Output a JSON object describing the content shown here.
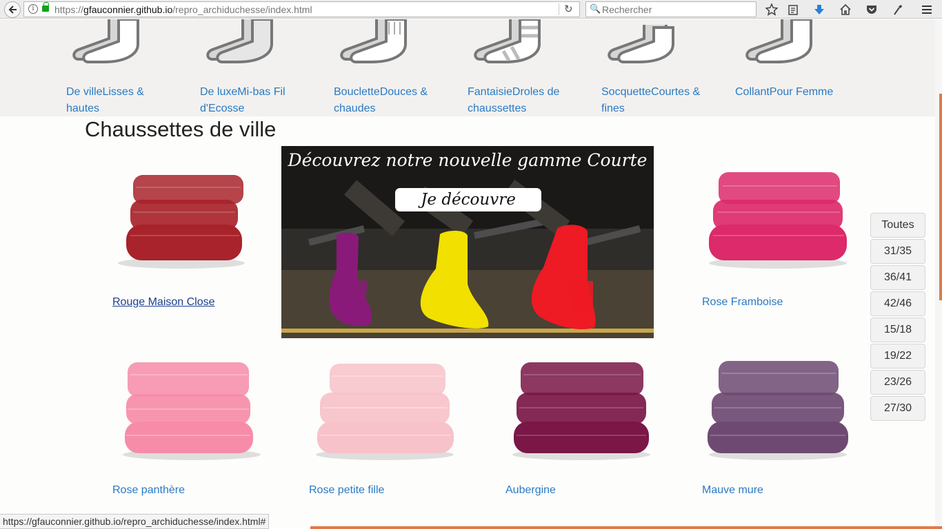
{
  "browser": {
    "url_prefix": "https://",
    "url_host": "gfauconnier.github.io",
    "url_path": "/repro_archiduchesse/index.html",
    "search_placeholder": "Rechercher"
  },
  "categories": [
    {
      "label": "De villeLisses & hautes"
    },
    {
      "label": "De luxeMi-bas Fil d'Ecosse"
    },
    {
      "label": "BoucletteDouces & chaudes"
    },
    {
      "label": "FantaisieDroles de chaussettes"
    },
    {
      "label": "SocquetteCourtes & fines"
    },
    {
      "label": "CollantPour Femme"
    }
  ],
  "section_title": "Chaussettes de ville",
  "products": [
    {
      "name": "Rouge Maison Close",
      "color": "#a8232b"
    },
    {
      "name": "Rose Framboise",
      "color": "#dc2a6a"
    },
    {
      "name": "Rose panthère",
      "color": "#f68ca8"
    },
    {
      "name": "Rose petite fille",
      "color": "#f7c2c9"
    },
    {
      "name": "Aubergine",
      "color": "#7a1746"
    },
    {
      "name": "Mauve mure",
      "color": "#6e4a72"
    }
  ],
  "banner": {
    "title": "Découvrez notre nouvelle gamme Courte",
    "cta": "Je découvre",
    "sock_colors": [
      "#8a1a7a",
      "#f2e000",
      "#ee1a24"
    ]
  },
  "size_filters": [
    "Toutes",
    "31/35",
    "36/41",
    "42/46",
    "15/18",
    "19/22",
    "23/26",
    "27/30"
  ],
  "status_url": "https://gfauconnier.github.io/repro_archiduchesse/index.html#",
  "colors": {
    "link": "#2a7ac4",
    "accent": "#e07a4a"
  }
}
